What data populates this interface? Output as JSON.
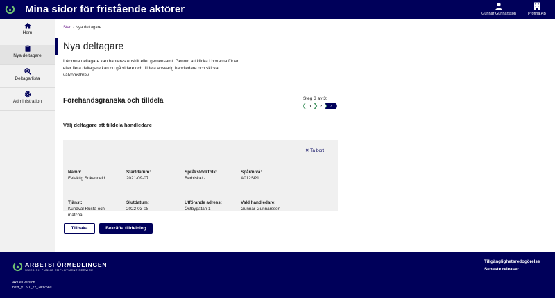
{
  "header": {
    "title": "Mina sidor för fristående aktörer",
    "user_name": "Gunnar Gunnarsson",
    "org_name": "Profina AB",
    "icons": {
      "logo": "af-logo-icon",
      "user": "user-icon",
      "org": "building-icon"
    }
  },
  "sidebar": {
    "items": [
      {
        "label": "Hem",
        "icon": "home-icon",
        "active": false
      },
      {
        "label": "Nya deltagare",
        "icon": "clipboard-icon",
        "active": true
      },
      {
        "label": "Deltagarlista",
        "icon": "search-user-icon",
        "active": false
      },
      {
        "label": "Administration",
        "icon": "gear-icon",
        "active": false
      }
    ]
  },
  "main": {
    "breadcrumb": {
      "start": "Start",
      "separator": "/",
      "current": "Nya deltagare"
    },
    "title": "Nya deltagare",
    "intro": "Inkomna deltagare kan hanteras enskilt eller gemensamt. Genom att klicka i boxarna för en eller flera deltagare kan du gå vidare och tilldela ansvarig handledare och skicka välkomstbrev.",
    "section_title": "Förehandsgranska och tilldela",
    "step": {
      "label": "Steg 3 av 3:",
      "steps": [
        "1",
        "2",
        "3"
      ],
      "current": 3,
      "done_color": "#3a8f5a",
      "active_color": "#00005a"
    },
    "sub_title": "Välj deltagare att tilldela handledare",
    "card": {
      "remove_label": "Ta bort",
      "fields": {
        "namn": {
          "label": "Namn:",
          "value": "Felaktig Sokandeld"
        },
        "startdatum": {
          "label": "Startdatum:",
          "value": "2021-09-07"
        },
        "sprakstod": {
          "label": "Språkstöd/Tolk:",
          "value": "Berbiska/ -"
        },
        "spar": {
          "label": "Spår/nivå:",
          "value": "A012SP1"
        },
        "tjanst": {
          "label": "Tjänst:",
          "value_line1": "Kundval Rusta och",
          "value_line2": "matcha"
        },
        "slutdatum": {
          "label": "Slutdatum:",
          "value": "2022-03-08"
        },
        "adress": {
          "label": "Utförande adress:",
          "value": "Östbygatan 1"
        },
        "handledare": {
          "label": "Vald handledare:",
          "value": "Gunnar Gunnarsson"
        }
      }
    },
    "buttons": {
      "back": "Tillbaka",
      "confirm": "Bekräfta tilldelning"
    }
  },
  "footer": {
    "brand": "ARBETSFÖRMEDLINGEN",
    "brand_sub": "SWEDISH PUBLIC EMPLOYMENT SERVICE",
    "version_label": "Aktuell version",
    "version_value": "next_v1.5.1_22_2a37569",
    "links": [
      "Tillgänglighetsredogörelse",
      "Senaste releaser"
    ]
  },
  "colors": {
    "brand_navy": "#00005a",
    "brand_green": "#3a8f5a",
    "breadcrumb_link": "#6b1f8a",
    "card_bg": "#f0f0f0"
  }
}
